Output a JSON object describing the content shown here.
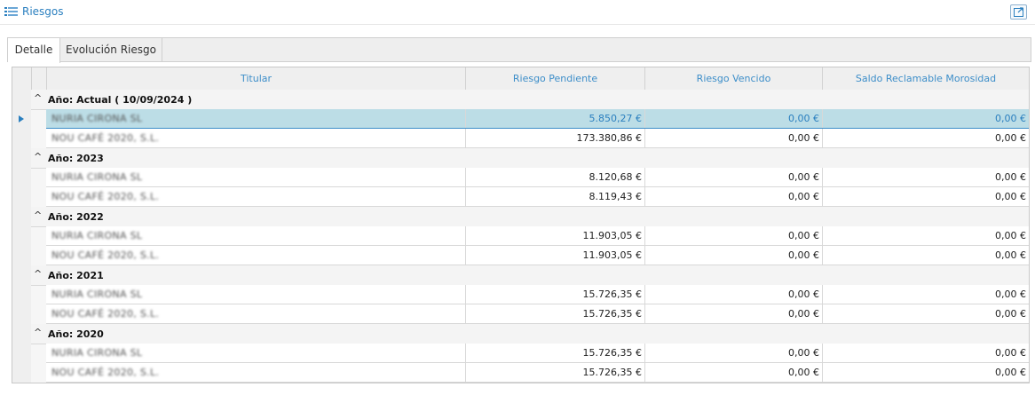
{
  "title": "Riesgos",
  "tabs": [
    {
      "label": "Detalle",
      "active": true
    },
    {
      "label": "Evolución Riesgo",
      "active": false
    }
  ],
  "columns": [
    "Titular",
    "Riesgo Pendiente",
    "Riesgo Vencido",
    "Saldo Reclamable Morosidad"
  ],
  "groups": [
    {
      "label": "Año: Actual ( 10/09/2024 )",
      "rows": [
        {
          "titular": "NURIA CIRONA SL",
          "pendiente": "5.850,27 €",
          "vencido": "0,00 €",
          "saldo": "0,00 €"
        },
        {
          "titular": "NOU CAFÉ 2020, S.L.",
          "pendiente": "173.380,86 €",
          "vencido": "0,00 €",
          "saldo": "0,00 €"
        }
      ]
    },
    {
      "label": "Año: 2023",
      "rows": [
        {
          "titular": "NURIA CIRONA SL",
          "pendiente": "8.120,68 €",
          "vencido": "0,00 €",
          "saldo": "0,00 €"
        },
        {
          "titular": "NOU CAFÉ 2020, S.L.",
          "pendiente": "8.119,43 €",
          "vencido": "0,00 €",
          "saldo": "0,00 €"
        }
      ]
    },
    {
      "label": "Año: 2022",
      "rows": [
        {
          "titular": "NURIA CIRONA SL",
          "pendiente": "11.903,05 €",
          "vencido": "0,00 €",
          "saldo": "0,00 €"
        },
        {
          "titular": "NOU CAFÉ 2020, S.L.",
          "pendiente": "11.903,05 €",
          "vencido": "0,00 €",
          "saldo": "0,00 €"
        }
      ]
    },
    {
      "label": "Año: 2021",
      "rows": [
        {
          "titular": "NURIA CIRONA SL",
          "pendiente": "15.726,35 €",
          "vencido": "0,00 €",
          "saldo": "0,00 €"
        },
        {
          "titular": "NOU CAFÉ 2020, S.L.",
          "pendiente": "15.726,35 €",
          "vencido": "0,00 €",
          "saldo": "0,00 €"
        }
      ]
    },
    {
      "label": "Año: 2020",
      "rows": [
        {
          "titular": "NURIA CIRONA SL",
          "pendiente": "15.726,35 €",
          "vencido": "0,00 €",
          "saldo": "0,00 €"
        },
        {
          "titular": "NOU CAFÉ 2020, S.L.",
          "pendiente": "15.726,35 €",
          "vencido": "0,00 €",
          "saldo": "0,00 €"
        }
      ]
    }
  ],
  "icons": {
    "title": "list-icon",
    "refresh": "refresh-icon",
    "group_toggle": "chevron-up-icon",
    "row_indicator": "triangle-right-icon"
  },
  "colors": {
    "accent": "#2a7fbf",
    "selected_row": "#bcdde6",
    "header_bg": "#efefef"
  }
}
